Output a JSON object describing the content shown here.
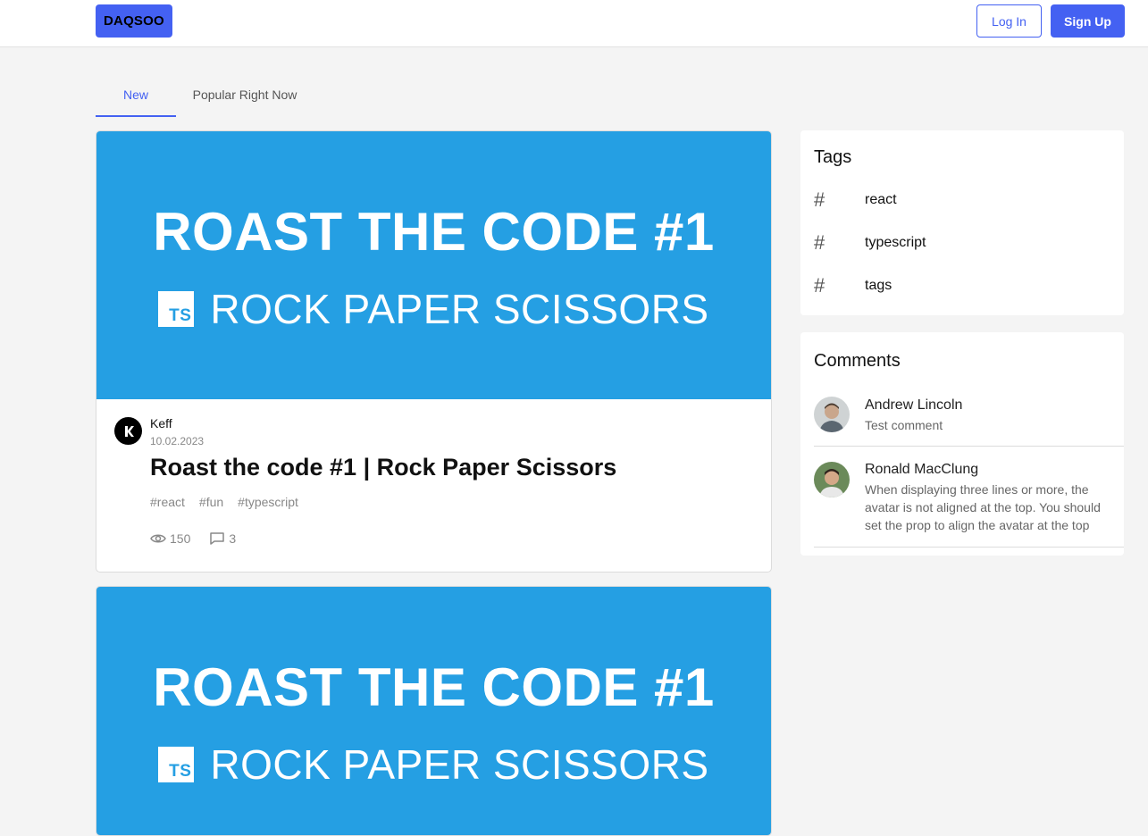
{
  "header": {
    "logo": "DAQSOO",
    "login_label": "Log In",
    "signup_label": "Sign Up"
  },
  "tabs": [
    {
      "label": "New",
      "active": true
    },
    {
      "label": "Popular Right Now",
      "active": false
    }
  ],
  "posts": [
    {
      "banner_title": "ROAST THE CODE #1",
      "banner_subtitle": "ROCK PAPER SCISSORS",
      "banner_badge": "TS",
      "author": "Keff",
      "date": "10.02.2023",
      "title": "Roast the code #1 | Rock Paper Scissors",
      "tags": [
        "#react",
        "#fun",
        "#typescript"
      ],
      "views": "150",
      "comments": "3"
    },
    {
      "banner_title": "ROAST THE CODE #1",
      "banner_subtitle": "ROCK PAPER SCISSORS",
      "banner_badge": "TS"
    }
  ],
  "sidebar": {
    "tags_title": "Tags",
    "tags": [
      "react",
      "typescript",
      "tags"
    ],
    "comments_title": "Comments",
    "comments": [
      {
        "name": "Andrew Lincoln",
        "text": "Test comment"
      },
      {
        "name": "Ronald MacClung",
        "text": "When displaying three lines or more, the avatar is not aligned at the top. You should set the prop to align the avatar at the top"
      }
    ]
  },
  "colors": {
    "accent": "#4461f2",
    "banner": "#259fe3",
    "background": "#f4f4f4"
  }
}
